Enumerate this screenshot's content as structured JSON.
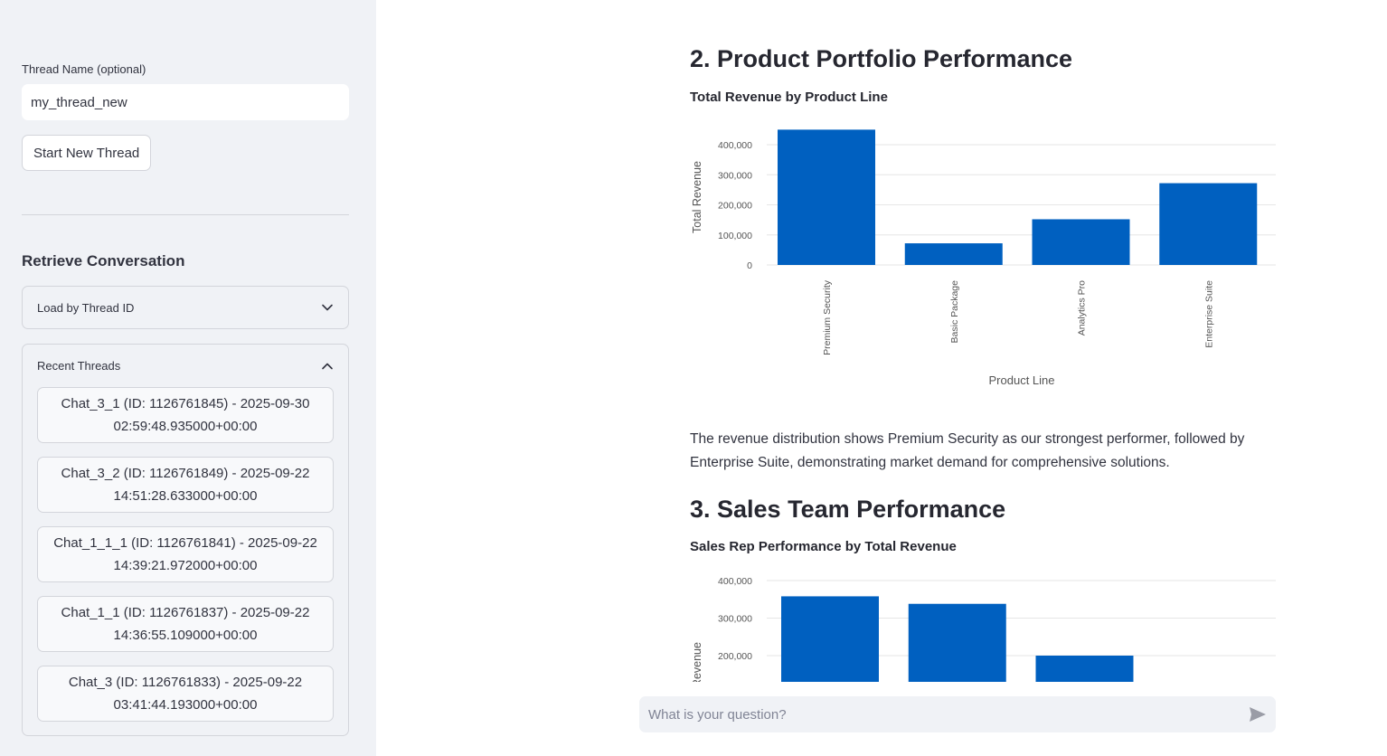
{
  "sidebar": {
    "thread_name_label": "Thread Name (optional)",
    "thread_name_value": "my_thread_new",
    "start_button": "Start New Thread",
    "retrieve_title": "Retrieve Conversation",
    "load_by_id_label": "Load by Thread ID",
    "recent_threads_label": "Recent Threads",
    "recent_threads": [
      {
        "line1": "Chat_3_1 (ID: 1126761845) - 2025-09-30",
        "line2": "02:59:48.935000+00:00"
      },
      {
        "line1": "Chat_3_2 (ID: 1126761849) - 2025-09-22",
        "line2": "14:51:28.633000+00:00"
      },
      {
        "line1": "Chat_1_1_1 (ID: 1126761841) - 2025-09-22",
        "line2": "14:39:21.972000+00:00"
      },
      {
        "line1": "Chat_1_1 (ID: 1126761837) - 2025-09-22",
        "line2": "14:36:55.109000+00:00"
      },
      {
        "line1": "Chat_3 (ID: 1126761833) - 2025-09-22",
        "line2": "03:41:44.193000+00:00"
      }
    ]
  },
  "main": {
    "section2_heading": "2. Product Portfolio Performance",
    "section2_paragraph": "The revenue distribution shows Premium Security as our strongest performer, followed by Enterprise Suite, demonstrating market demand for comprehensive solutions.",
    "section3_heading": "3. Sales Team Performance"
  },
  "chat": {
    "placeholder": "What is your question?"
  },
  "colors": {
    "bar": "#0060c0",
    "sidebar_bg": "#f0f2f6"
  },
  "icons": {
    "load_by_id": "chevron-down-icon",
    "recent_threads": "chevron-up-icon",
    "send": "send-icon"
  },
  "chart_data": [
    {
      "type": "bar",
      "title": "Total Revenue by Product Line",
      "xlabel": "Product Line",
      "ylabel": "Total Revenue",
      "categories": [
        "Premium Security",
        "Basic Package",
        "Analytics Pro",
        "Enterprise Suite"
      ],
      "values": [
        450000,
        72000,
        152000,
        272000
      ],
      "yticks": [
        "0",
        "100,000",
        "200,000",
        "300,000",
        "400,000"
      ],
      "ylim": [
        0,
        400000
      ],
      "grid": true
    },
    {
      "type": "bar",
      "title": "Sales Rep Performance by Total Revenue",
      "ylabel": "Total Revenue",
      "values": [
        358000,
        338000,
        200000
      ],
      "yticks": [
        "200,000",
        "300,000",
        "400,000"
      ],
      "ylim": [
        150000,
        400000
      ],
      "grid": true,
      "note": "chart partially visible; cut off by viewport"
    }
  ]
}
